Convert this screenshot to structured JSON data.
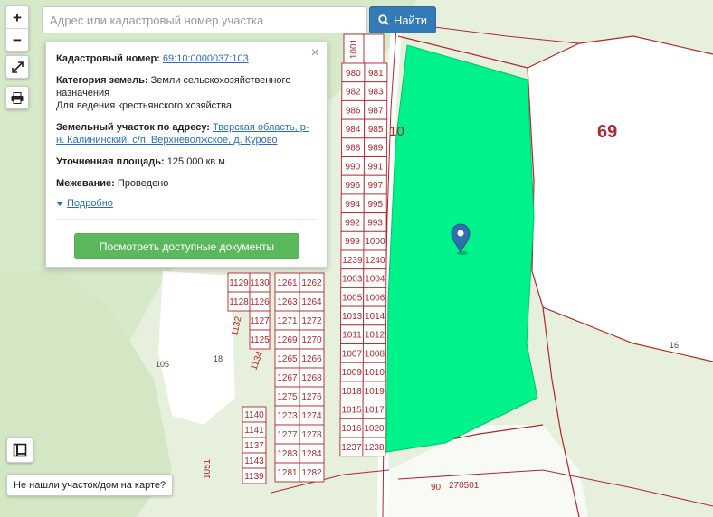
{
  "controls": {
    "zoom_in": "+",
    "zoom_out": "−",
    "fullscreen_icon": "expand-icon",
    "print_icon": "printer-icon",
    "layers_icon": "layers-icon"
  },
  "search": {
    "placeholder": "Адрес или кадастровый номер участка",
    "value": "",
    "button_label": "Найти"
  },
  "popup": {
    "cadastral_label": "Кадастровый номер:",
    "cadastral_value": "69:10:0000037:103",
    "category_label": "Категория земель:",
    "category_value": "Земли сельскохозяйственного назначения",
    "use_value": "Для ведения крестьянского хозяйства",
    "address_label": "Земельный участок по адресу:",
    "address_value": "Тверская область, р-н. Калининский, с/п. Верхневолжское, д. Курово",
    "area_label": "Уточненная площадь:",
    "area_value": "125 000 кв.м.",
    "survey_label": "Межевание:",
    "survey_value": "Проведено",
    "more_link": "Подробно",
    "docs_button": "Посмотреть доступные документы"
  },
  "map": {
    "highlight_color": "#00f38a",
    "parcel_line_color": "#b3262b",
    "region_label": "69",
    "block_label": "10",
    "lots_right": [
      [
        "1001",
        ""
      ],
      [
        "980",
        "981"
      ],
      [
        "982",
        "983"
      ],
      [
        "986",
        "987"
      ],
      [
        "984",
        "985"
      ],
      [
        "988",
        "989"
      ],
      [
        "990",
        "991"
      ],
      [
        "996",
        "997"
      ],
      [
        "994",
        "995"
      ],
      [
        "992",
        "993"
      ],
      [
        "999",
        "1000"
      ],
      [
        "1239",
        "1240"
      ],
      [
        "1003",
        "1004"
      ],
      [
        "1005",
        "1006"
      ],
      [
        "1013",
        "1014"
      ],
      [
        "1011",
        "1012"
      ],
      [
        "1007",
        "1008"
      ],
      [
        "1009",
        "1010"
      ],
      [
        "1018",
        "1019"
      ],
      [
        "1015",
        "1017"
      ],
      [
        "1016",
        "1020"
      ],
      [
        "1237",
        "1238"
      ]
    ],
    "lots_middle": [
      [
        "1261",
        "1262"
      ],
      [
        "1263",
        "1264"
      ],
      [
        "1271",
        "1272"
      ],
      [
        "1269",
        "1270"
      ],
      [
        "1265",
        "1266"
      ],
      [
        "1267",
        "1268"
      ],
      [
        "1275",
        "1276"
      ],
      [
        "1273",
        "1274"
      ],
      [
        "1277",
        "1278"
      ],
      [
        "1283",
        "1284"
      ],
      [
        "1281",
        "1282"
      ]
    ],
    "lots_left": [
      [
        "1129",
        "1130"
      ],
      [
        "1128",
        "1126"
      ],
      [
        "",
        "1127"
      ],
      [
        "",
        "1125"
      ]
    ],
    "lots_left_bottom": [
      "1140",
      "1141",
      "1137",
      "1143",
      "1139"
    ],
    "misc_labels": [
      "1132",
      "1134",
      "1051",
      "21",
      "21",
      "105",
      "18",
      "16",
      "90",
      "270501"
    ]
  },
  "footer": {
    "not_found": "Не нашли участок/дом на карте?"
  }
}
